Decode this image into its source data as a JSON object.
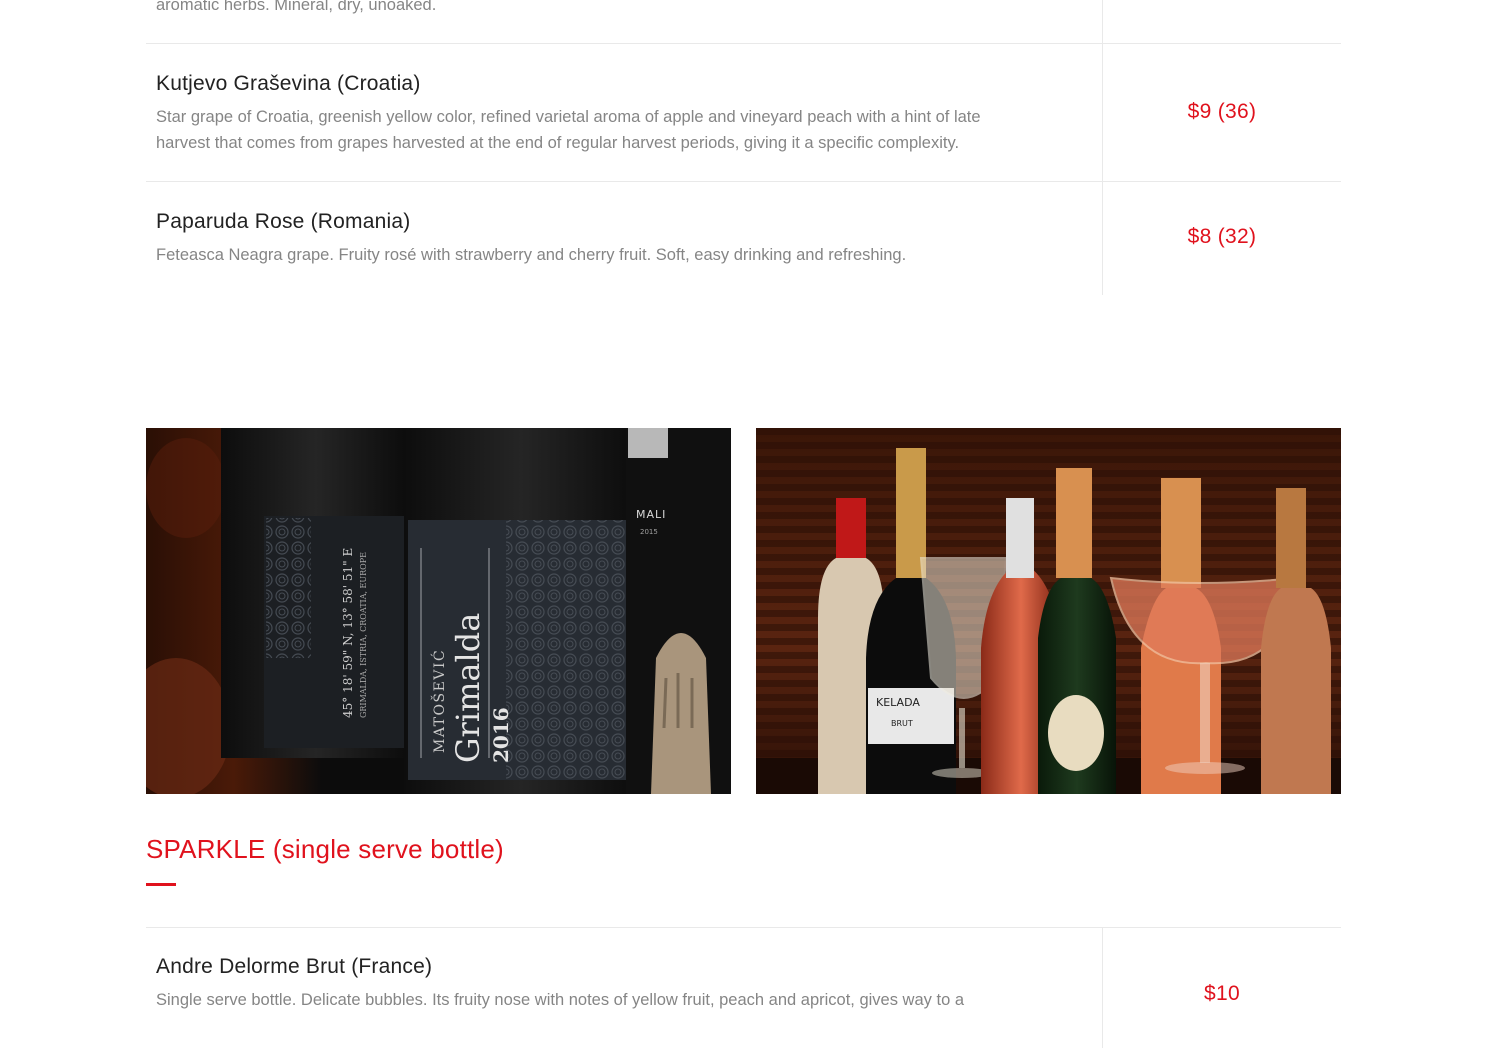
{
  "previous_item": {
    "desc_tail": "aromatic herbs. Mineral, dry, unoaked."
  },
  "wines": [
    {
      "name": "Kutjevo Graševina (Croatia)",
      "desc_line1": "Star grape of Croatia, greenish yellow color, refined varietal aroma of apple and vineyard peach with a hint of late",
      "desc_line2": "harvest that comes from grapes harvested at the end of regular harvest periods, giving it a specific complexity.",
      "price": "$9 (36)"
    },
    {
      "name": "Paparuda Rose (Romania)",
      "desc_line1": "Feteasca Neagra grape. Fruity rosé with strawberry and cherry fruit. Soft, easy drinking and refreshing.",
      "price": "$8 (32)"
    }
  ],
  "photos": {
    "left": {
      "label_brand": "MATOŠEVIĆ",
      "label_name": "Grimalda",
      "label_year": "2016",
      "label_coords": "45° 18' 59\" N, 13° 58' 51\" E",
      "label_place": "GRIMALDA, ISTRIA, CROATIA, EUROPE",
      "back_bottle": "MALI",
      "back_year": "2015"
    },
    "right": {
      "bottle_label": "KELADA",
      "bottle_sub": "BRUT"
    }
  },
  "sparkle_section": {
    "title": "SPARKLE (single serve bottle)",
    "first_item": {
      "name": "Andre Delorme Brut (France)",
      "desc_partial": "Single serve bottle. Delicate bubbles. Its fruity nose with notes of yellow fruit, peach and apricot, gives way to a",
      "price": "$10"
    }
  },
  "colors": {
    "accent": "#e0121d",
    "name_text": "#222222",
    "desc_text": "#858585",
    "divider": "#e9e9e9"
  }
}
